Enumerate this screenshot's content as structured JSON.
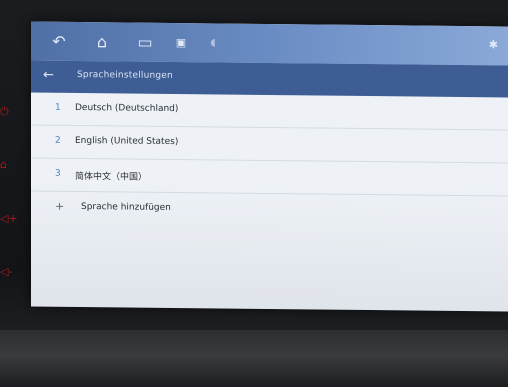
{
  "colors": {
    "statusbar": "#5f80b8",
    "appbar": "#3f5d95",
    "accent": "#4f7fc0",
    "screen_bg": "#eef2f7"
  },
  "navbar": {
    "icons": [
      "back-icon",
      "home-icon",
      "recent-apps-icon",
      "screenshot-icon",
      "volume-icon"
    ]
  },
  "status": {
    "icons": [
      "bluetooth-icon"
    ]
  },
  "appbar": {
    "title": "Spracheinstellungen"
  },
  "languages": [
    {
      "num": "1",
      "label": "Deutsch (Deutschland)"
    },
    {
      "num": "2",
      "label": "English (United States)"
    },
    {
      "num": "3",
      "label": "简体中文（中国）"
    }
  ],
  "add_language": {
    "icon": "+",
    "label": "Sprache hinzufügen"
  }
}
